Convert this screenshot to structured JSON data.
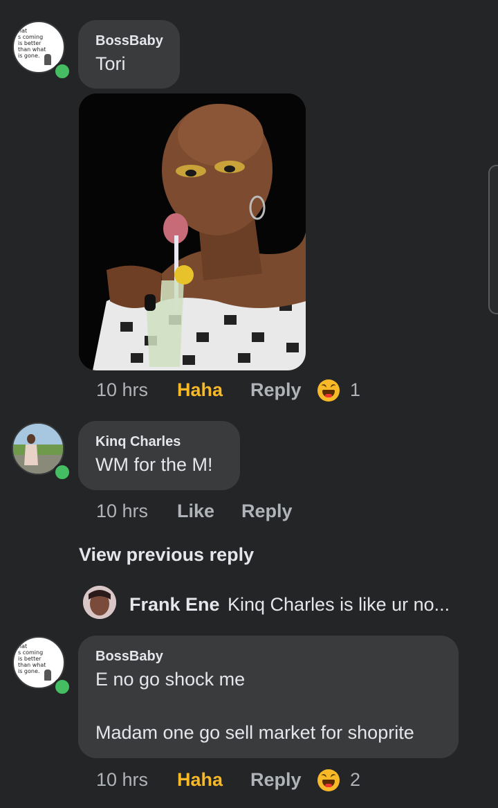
{
  "comments": [
    {
      "author": "BossBaby",
      "text": "Tori",
      "avatar_quote": "hat\ns coming\nis better\nthan what\nis gone.",
      "time": "10 hrs",
      "reaction_label": "Haha",
      "reply_label": "Reply",
      "reaction_count": "1",
      "reaction_icon": "laughing-emoji-icon"
    },
    {
      "author": "Kinq Charles",
      "text": "WM for the M!",
      "time": "10 hrs",
      "reaction_label": "Like",
      "reply_label": "Reply"
    },
    {
      "author": "BossBaby",
      "text_line1": "E no go shock me",
      "text_line2": "Madam one go sell market for shoprite",
      "avatar_quote": "hat\ns coming\nis better\nthan what\nis gone.",
      "time": "10 hrs",
      "reaction_label": "Haha",
      "reply_label": "Reply",
      "reaction_count": "2",
      "reaction_icon": "laughing-emoji-icon"
    }
  ],
  "thread": {
    "view_previous_label": "View previous reply",
    "reply_preview_author": "Frank Ene",
    "reply_preview_text": "Kinq Charles is like ur no..."
  },
  "colors": {
    "background": "#242526",
    "bubble": "#3a3b3c",
    "haha_accent": "#f7b928",
    "online": "#45bd62"
  }
}
